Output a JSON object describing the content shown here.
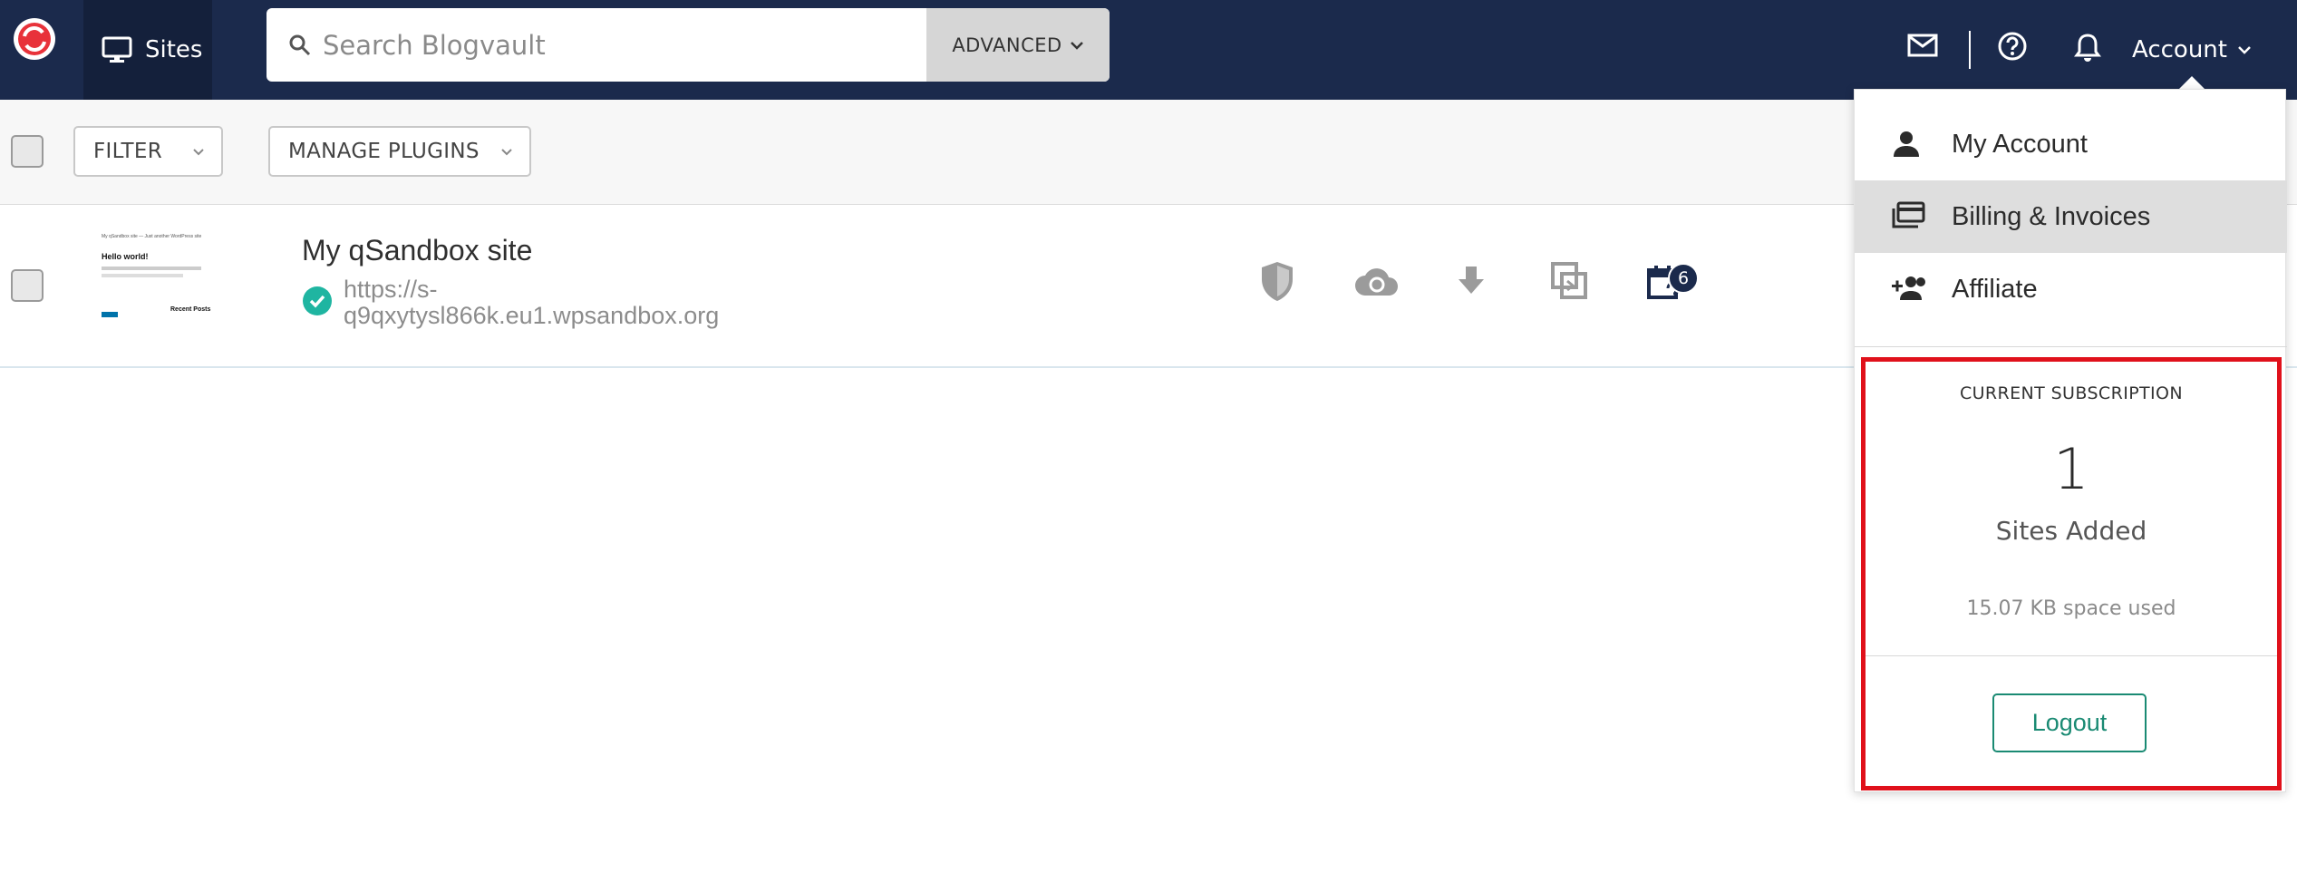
{
  "nav": {
    "sites_label": "Sites",
    "search_placeholder": "Search Blogvault",
    "advanced_label": "ADVANCED",
    "account_label": "Account"
  },
  "toolbar": {
    "filter_label": "FILTER",
    "manage_plugins_label": "MANAGE PLUGINS"
  },
  "site": {
    "title": "My qSandbox site",
    "url": "https://s-q9qxytysl866k.eu1.wpsandbox.org",
    "thumbnail": {
      "header": "My qSandbox site — Just another WordPress site",
      "heading": "Hello world!",
      "widget": "Recent Posts"
    },
    "scheduled_badge": "6"
  },
  "account_menu": {
    "items": [
      {
        "label": "My Account",
        "icon": "person-icon"
      },
      {
        "label": "Billing & Invoices",
        "icon": "billing-card-icon"
      },
      {
        "label": "Affiliate",
        "icon": "add-user-icon"
      }
    ],
    "subscription": {
      "title": "CURRENT SUBSCRIPTION",
      "sites_count": "1",
      "sites_label": "Sites Added",
      "space_used": "15.07 KB space used",
      "logout_label": "Logout"
    }
  },
  "colors": {
    "nav_bg": "#1b2a4c",
    "accent": "#1fb5a1",
    "highlight_border": "#e0111b"
  }
}
